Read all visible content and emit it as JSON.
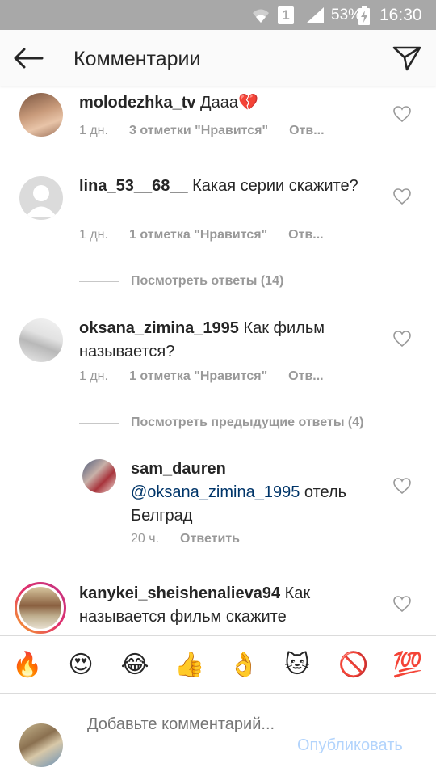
{
  "status_bar": {
    "sim": "1",
    "battery": "53%",
    "time": "16:30"
  },
  "header": {
    "title": "Комментарии"
  },
  "comments": [
    {
      "username": "molodezhka_tv",
      "text": "Дааа💔",
      "time": "1 дн.",
      "likes": "3 отметки \"Нравится\"",
      "reply": "Отв..."
    },
    {
      "username": "lina_53__68__",
      "text": "Какая серии скажите?",
      "time": "1 дн.",
      "likes": "1 отметка \"Нравится\"",
      "reply": "Отв...",
      "view_replies": "Посмотреть ответы (14)"
    },
    {
      "username": "oksana_zimina_1995",
      "text": "Как фильм называется?",
      "time": "1 дн.",
      "likes": "1 отметка \"Нравится\"",
      "reply": "Отв...",
      "view_replies": "Посмотреть предыдущие ответы (4)"
    },
    {
      "username": "sam_dauren",
      "mention": "@oksana_zimina_1995",
      "text": "отель Белград",
      "time": "20 ч.",
      "reply": "Ответить"
    },
    {
      "username": "kanykei_sheishenalieva94",
      "text": "Как называется фильм скажите"
    }
  ],
  "emoji_bar": [
    {
      "glyph": "🔥",
      "icon": "fire-emoji"
    },
    {
      "glyph": "😍",
      "icon": "heart-eyes-emoji"
    },
    {
      "glyph": "😂",
      "icon": "tears-of-joy-emoji"
    },
    {
      "glyph": "👍",
      "icon": "thumbs-up-emoji"
    },
    {
      "glyph": "👌",
      "icon": "ok-hand-emoji"
    },
    {
      "glyph": "🐱",
      "icon": "cat-emoji"
    },
    {
      "glyph": "🚫",
      "icon": "prohibited-emoji"
    },
    {
      "glyph": "💯",
      "icon": "hundred-emoji"
    }
  ],
  "composer": {
    "placeholder": "Добавьте комментарий...",
    "publish": "Опубликовать"
  },
  "colors": {
    "status_bar": "#a8a8a8",
    "mention": "#003569",
    "publish_disabled": "#b3d4fc",
    "meta": "#999999"
  }
}
